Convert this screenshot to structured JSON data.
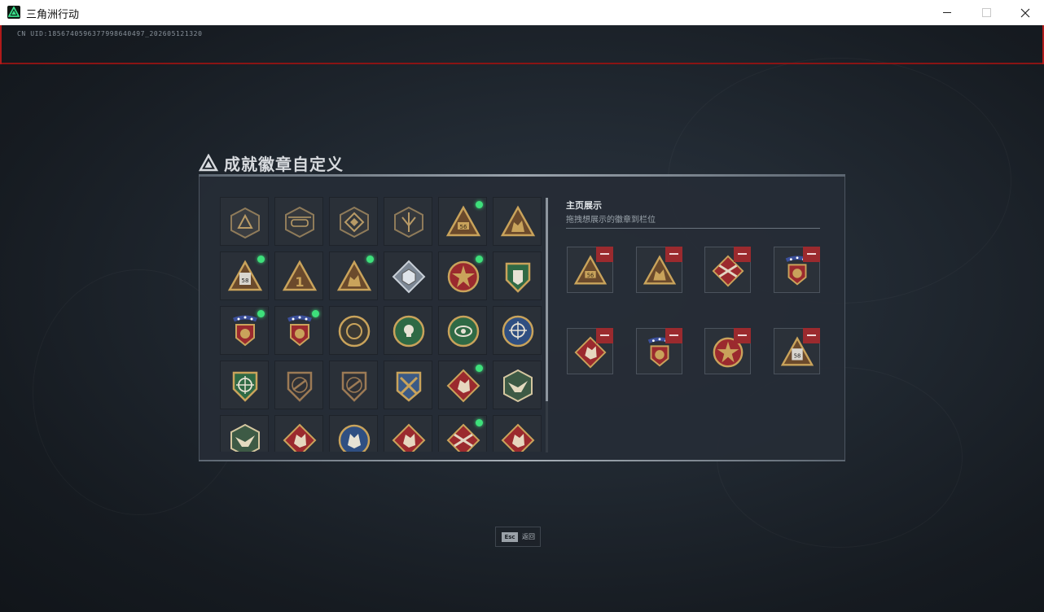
{
  "window": {
    "title": "三角洲行动",
    "icon": "delta-logo-icon"
  },
  "uid": "CN UID:1856740596377998640497_202605121320",
  "panel": {
    "title": "成就徽章自定义",
    "title_icon": "delta-triangle-icon"
  },
  "showcase": {
    "title": "主页展示",
    "subtitle": "拖拽想展示的徽章到栏位"
  },
  "badges": [
    {
      "icon": "triangle-emblem-badge",
      "new": false
    },
    {
      "icon": "helicopter-badge",
      "new": false
    },
    {
      "icon": "diamond-compass-badge",
      "new": false
    },
    {
      "icon": "sword-shield-badge",
      "new": false
    },
    {
      "icon": "triangle-56-badge",
      "new": true
    },
    {
      "icon": "triangle-bag-badge",
      "new": false
    },
    {
      "icon": "triangle-58-badge",
      "new": true
    },
    {
      "icon": "triangle-1-badge",
      "new": false
    },
    {
      "icon": "triangle-soldiers-badge",
      "new": true
    },
    {
      "icon": "diamond-cube-badge",
      "new": false
    },
    {
      "icon": "star-shield-badge",
      "new": true
    },
    {
      "icon": "green-shield-badge",
      "new": false
    },
    {
      "icon": "stars-medal-badge",
      "new": true
    },
    {
      "icon": "stars-wolf-badge",
      "new": true
    },
    {
      "icon": "round-ring-badge",
      "new": false
    },
    {
      "icon": "green-skull-badge",
      "new": false
    },
    {
      "icon": "green-eye-badge",
      "new": false
    },
    {
      "icon": "blue-crosshair-badge",
      "new": false
    },
    {
      "icon": "green-crosshair-shield-badge",
      "new": false
    },
    {
      "icon": "bronze-rifle-shield-badge",
      "new": false
    },
    {
      "icon": "bronze-rifle-shield-2-badge",
      "new": false
    },
    {
      "icon": "gold-crossed-rifles-badge",
      "new": false
    },
    {
      "icon": "red-wolf-diamond-badge",
      "new": true
    },
    {
      "icon": "hexagon-eagle-badge",
      "new": false
    },
    {
      "icon": "hexagon-eagle-2-badge",
      "new": false
    },
    {
      "icon": "red-dragon-badge",
      "new": false
    },
    {
      "icon": "blue-wolf-badge",
      "new": false
    },
    {
      "icon": "red-fist-badge",
      "new": false
    },
    {
      "icon": "red-crossed-guns-badge",
      "new": true
    },
    {
      "icon": "red-wolf-2-badge",
      "new": false
    }
  ],
  "slots": [
    {
      "icon": "triangle-56-badge",
      "remove": "remove-icon"
    },
    {
      "icon": "triangle-soldiers-badge",
      "remove": "remove-icon"
    },
    {
      "icon": "red-crossed-guns-badge",
      "remove": "remove-icon"
    },
    {
      "icon": "stars-wolf-badge",
      "remove": "remove-icon"
    },
    {
      "icon": "red-wolf-diamond-badge",
      "remove": "remove-icon"
    },
    {
      "icon": "stars-medal-badge",
      "remove": "remove-icon"
    },
    {
      "icon": "star-shield-badge",
      "remove": "remove-icon"
    },
    {
      "icon": "triangle-58-badge",
      "remove": "remove-icon"
    }
  ],
  "footer": {
    "esc_key": "Esc",
    "esc_label": "返回"
  },
  "colors": {
    "gold": "#c9a35b",
    "bronze": "#9c7a55",
    "red": "#9b2a2e",
    "green": "#2f6a45",
    "blue": "#2f4f82",
    "new_dot": "#3ee07b"
  }
}
